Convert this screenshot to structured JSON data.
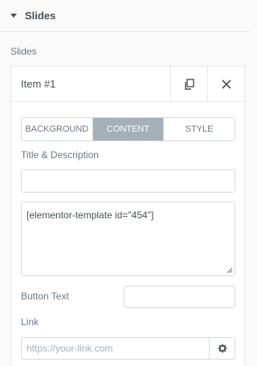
{
  "section": {
    "title": "Slides",
    "caret_icon": "caret-down-icon"
  },
  "repeater": {
    "label": "Slides",
    "item": {
      "title": "Item #1",
      "duplicate_icon": "duplicate-icon",
      "remove_icon": "close-icon"
    }
  },
  "tabs": [
    {
      "label": "BACKGROUND",
      "active": false
    },
    {
      "label": "CONTENT",
      "active": true
    },
    {
      "label": "STYLE",
      "active": false
    }
  ],
  "fields": {
    "title_description": {
      "label": "Title & Description",
      "value": ""
    },
    "description": {
      "value": "[elementor-template id=\"454\"]"
    },
    "button_text": {
      "label": "Button Text",
      "value": ""
    },
    "link": {
      "label": "Link",
      "placeholder": "https://your-link.com",
      "options_icon": "gear-icon"
    }
  },
  "colors": {
    "active_tab": "#a4afb7",
    "border": "#d5dadf",
    "text": "#6d7882"
  }
}
